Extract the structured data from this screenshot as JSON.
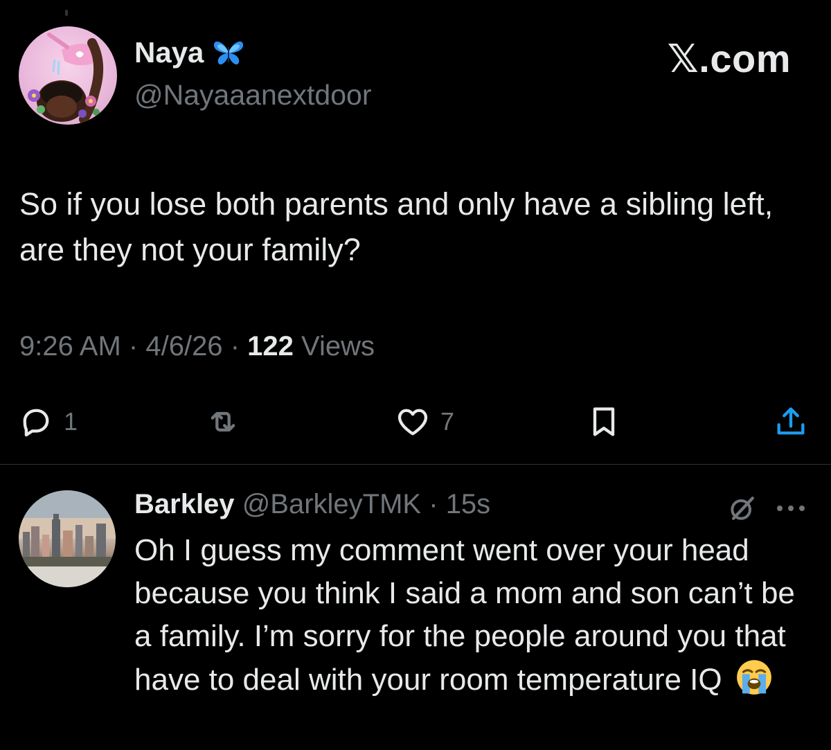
{
  "tweet": {
    "author_name": "Naya",
    "author_handle": "@Nayaaanextdoor",
    "verified_badge_icon": "butterfly-icon",
    "brand": "𝕏.com",
    "text": "So if you lose both parents and only have a sibling left, are they not your family?",
    "time": "9:26 AM",
    "date": "4/6/26",
    "separator": "·",
    "views_count": "122",
    "views_label": "Views",
    "actions": {
      "reply_count": "1",
      "like_count": "7"
    }
  },
  "reply": {
    "author_name": "Barkley",
    "author_handle": "@BarkleyTMK",
    "separator": "·",
    "time_ago": "15s",
    "text": "Oh I guess my comment went over your head because you think I said a mom and son can’t be a family. I’m sorry for the people around you that have to deal with your room temperature IQ",
    "emoji_icon": "loudly-crying-face-icon"
  },
  "colors": {
    "background": "#000000",
    "text_primary": "#e7e9ea",
    "text_secondary": "#71767b",
    "divider": "#2f3336",
    "badge_blue": "#1d9bf0"
  }
}
